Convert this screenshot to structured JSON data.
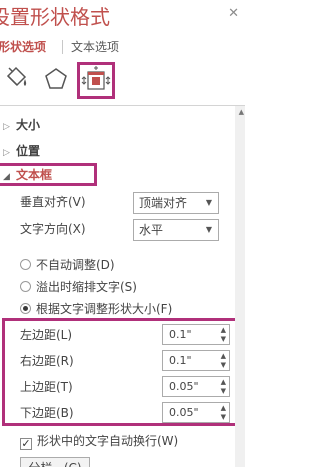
{
  "pane": {
    "title": "设置形状格式",
    "close_glyph": "✕",
    "tabs": [
      {
        "label": "形状选项"
      },
      {
        "label": "文本选项"
      }
    ],
    "icons": [
      "paint-bucket-icon",
      "pentagon-icon",
      "textbox-layout-icon"
    ]
  },
  "sections": {
    "size": {
      "label": "大小",
      "arrow": "▷"
    },
    "position": {
      "label": "位置",
      "arrow": "▷"
    },
    "textbox": {
      "label": "文本框",
      "arrow": "◢"
    }
  },
  "textbox": {
    "valign_label": "垂直对齐(V)",
    "valign_value": "顶端对齐",
    "tdir_label": "文字方向(X)",
    "tdir_value": "水平",
    "radios": [
      {
        "label": "不自动调整(D)",
        "checked": false
      },
      {
        "label": "溢出时缩排文字(S)",
        "checked": false
      },
      {
        "label": "根据文字调整形状大小(F)",
        "checked": true
      }
    ],
    "margins": [
      {
        "label": "左边距(L)",
        "value": "0.1\""
      },
      {
        "label": "右边距(R)",
        "value": "0.1\""
      },
      {
        "label": "上边距(T)",
        "value": "0.05\""
      },
      {
        "label": "下边距(B)",
        "value": "0.05\""
      }
    ],
    "wrap_label": "形状中的文字自动换行(W)",
    "wrap_checked": true,
    "columns_label": "分栏...(C)"
  },
  "colors": {
    "accent": "#c0504d",
    "highlight": "#b0307a"
  }
}
